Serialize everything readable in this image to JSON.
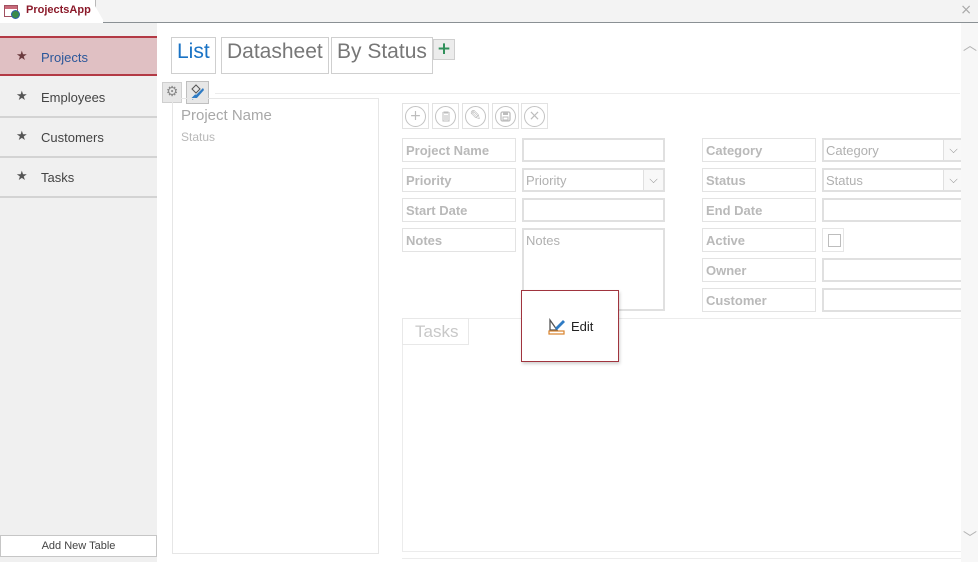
{
  "app": {
    "title": "ProjectsApp",
    "close_icon": "×"
  },
  "sidebar": {
    "items": [
      {
        "label": "Projects",
        "icon": "star-icon",
        "active": true
      },
      {
        "label": "Employees",
        "icon": "star-icon",
        "active": false
      },
      {
        "label": "Customers",
        "icon": "star-icon",
        "active": false
      },
      {
        "label": "Tasks",
        "icon": "star-icon",
        "active": false
      }
    ],
    "star_glyph": "★",
    "add_table_label": "Add New Table"
  },
  "views": {
    "tabs": [
      {
        "label": "List",
        "active": true
      },
      {
        "label": "Datasheet",
        "active": false
      },
      {
        "label": "By Status",
        "active": false
      }
    ],
    "add_view_glyph": "+"
  },
  "toolbar": {
    "gear_glyph": "⚙"
  },
  "list_pane": {
    "primary_field": "Project Name",
    "secondary_field": "Status"
  },
  "actions": [
    {
      "name": "add",
      "glyph": "+"
    },
    {
      "name": "delete",
      "glyph": "🗑"
    },
    {
      "name": "edit",
      "glyph": "✎"
    },
    {
      "name": "save",
      "glyph": "▣"
    },
    {
      "name": "cancel",
      "glyph": "×"
    }
  ],
  "form": {
    "left": [
      {
        "label": "Project Name",
        "type": "text",
        "value": "",
        "placeholder": ""
      },
      {
        "label": "Priority",
        "type": "select",
        "value": "",
        "placeholder": "Priority"
      },
      {
        "label": "Start Date",
        "type": "text",
        "value": "",
        "placeholder": ""
      },
      {
        "label": "Notes",
        "type": "textarea",
        "value": "",
        "placeholder": "Notes"
      }
    ],
    "right": [
      {
        "label": "Category",
        "type": "select",
        "value": "",
        "placeholder": "Category"
      },
      {
        "label": "Status",
        "type": "select",
        "value": "",
        "placeholder": "Status"
      },
      {
        "label": "End Date",
        "type": "text",
        "value": "",
        "placeholder": ""
      },
      {
        "label": "Active",
        "type": "checkbox",
        "checked": false
      },
      {
        "label": "Owner",
        "type": "text",
        "value": "",
        "placeholder": ""
      },
      {
        "label": "Customer",
        "type": "text",
        "value": "",
        "placeholder": ""
      }
    ],
    "dropdown_glyph": "⌵"
  },
  "subview": {
    "tab_label": "Tasks"
  },
  "popup": {
    "label": "Edit"
  },
  "scrollbar": {
    "up_glyph": "︿",
    "down_glyph": "﹀"
  }
}
